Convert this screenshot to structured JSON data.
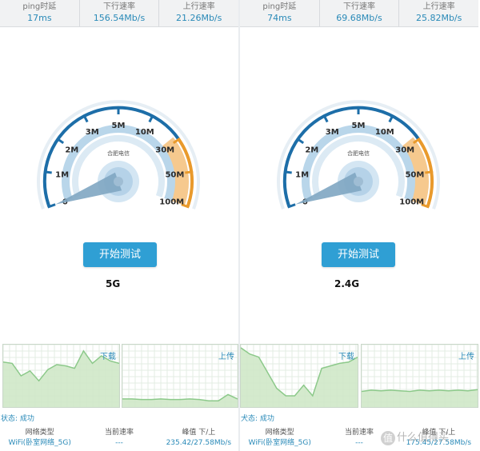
{
  "panels": [
    {
      "stats": [
        {
          "label": "ping时延",
          "value": "17ms"
        },
        {
          "label": "下行速率",
          "value": "156.54Mb/s"
        },
        {
          "label": "上行速率",
          "value": "21.26Mb/s"
        }
      ],
      "gauge": {
        "provider": "合肥电信",
        "ticks": [
          "0",
          "1M",
          "2M",
          "3M",
          "5M",
          "10M",
          "30M",
          "50M",
          "100M"
        ],
        "needle_at_tick": "0"
      },
      "start_button": "开始测试",
      "band": "5G",
      "download_title": "下载",
      "upload_title": "上传",
      "download_profile": [
        0.72,
        0.7,
        0.5,
        0.58,
        0.42,
        0.6,
        0.68,
        0.66,
        0.62,
        0.9,
        0.7,
        0.82,
        0.74,
        0.7
      ],
      "upload_profile": [
        0.13,
        0.13,
        0.12,
        0.12,
        0.13,
        0.12,
        0.12,
        0.13,
        0.12,
        0.1,
        0.1,
        0.2,
        0.13
      ],
      "status": "状态: 成功",
      "footer": [
        {
          "label": "网络类型",
          "value": "WiFi(卧室网络_5G)"
        },
        {
          "label": "当前速率",
          "value": "---"
        },
        {
          "label": "峰值  下/上",
          "value": "235.42/27.58Mb/s"
        }
      ]
    },
    {
      "stats": [
        {
          "label": "ping时延",
          "value": "74ms"
        },
        {
          "label": "下行速率",
          "value": "69.68Mb/s"
        },
        {
          "label": "上行速率",
          "value": "25.82Mb/s"
        }
      ],
      "gauge": {
        "provider": "合肥电信",
        "ticks": [
          "0",
          "1M",
          "2M",
          "3M",
          "5M",
          "10M",
          "30M",
          "50M",
          "100M"
        ],
        "needle_at_tick": "0"
      },
      "start_button": "开始测试",
      "band": "2.4G",
      "download_title": "下载",
      "upload_title": "上传",
      "download_profile": [
        0.95,
        0.85,
        0.8,
        0.55,
        0.3,
        0.18,
        0.18,
        0.35,
        0.18,
        0.62,
        0.66,
        0.7,
        0.72,
        0.8
      ],
      "upload_profile": [
        0.25,
        0.27,
        0.26,
        0.27,
        0.26,
        0.25,
        0.27,
        0.26,
        0.27,
        0.26,
        0.27,
        0.26,
        0.28
      ],
      "status": "犬态: 成功",
      "footer": [
        {
          "label": "网络类型",
          "value": "WiFi(卧室网络_5G)"
        },
        {
          "label": "当前速率",
          "value": "---"
        },
        {
          "label": "峰值  下/上",
          "value": "175.45/27.58Mb/s"
        }
      ]
    }
  ],
  "watermark": {
    "logo_glyph": "值",
    "text": "什么值得买"
  },
  "colors": {
    "accent": "#2f9fd4",
    "text_blue": "#2a8ab8",
    "gauge_blue": "#1d6ea8",
    "gauge_orange": "#e99a2c",
    "graph_fill": "#cfe8c8",
    "graph_line": "#8cc98a"
  }
}
